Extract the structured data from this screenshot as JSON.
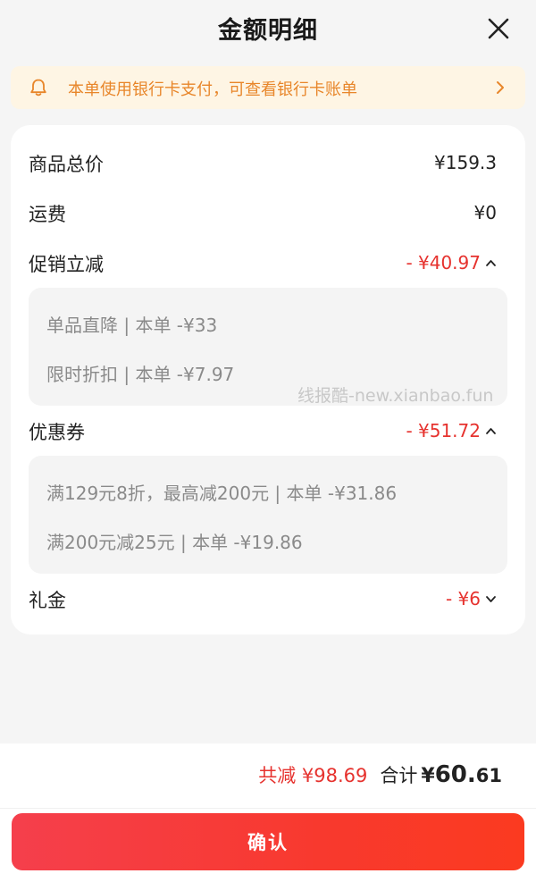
{
  "header": {
    "title": "金额明细",
    "close_icon": "close-icon"
  },
  "notice": {
    "text": "本单使用银行卡支付，可查看银行卡账单",
    "icon": "bell-icon",
    "color": "#e8862a",
    "background": "#fef5e4"
  },
  "details": {
    "goods_total": {
      "label": "商品总价",
      "value": "¥159.3"
    },
    "shipping": {
      "label": "运费",
      "value": "¥0"
    },
    "promotion": {
      "label": "促销立减",
      "value": "- ¥40.97",
      "expanded": true,
      "items": [
        "单品直降 | 本单 -¥33",
        "限时折扣 | 本单 -¥7.97"
      ]
    },
    "coupon": {
      "label": "优惠券",
      "value": "- ¥51.72",
      "expanded": true,
      "items": [
        "满129元8折，最高减200元 | 本单 -¥31.86",
        "满200元减25元 | 本单 -¥19.86"
      ]
    },
    "gift_cash": {
      "label": "礼金",
      "value": "- ¥6",
      "expanded": false
    }
  },
  "watermark": "线报酷-new.xianbao.fun",
  "summary": {
    "saved": "共减 ¥98.69",
    "total_label": "合计",
    "total_symbol": "¥",
    "total_int": "60.",
    "total_dec": "61"
  },
  "confirm_label": "确认",
  "colors": {
    "accent_red": "#e6322e",
    "button_red": "#f8392e"
  }
}
